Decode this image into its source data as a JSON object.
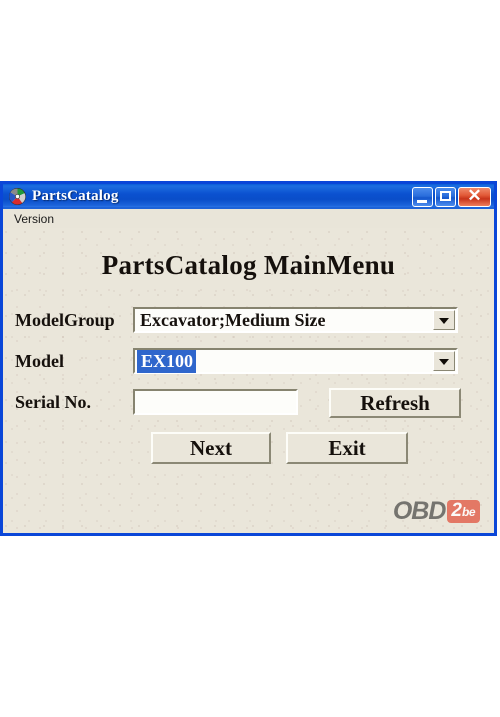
{
  "window": {
    "title": "PartsCatalog",
    "icon": "disc-icon",
    "titlebar_color": "#0b51d0",
    "border_color": "#0a46d8",
    "client_bg_color": "#eae6da",
    "buttons": {
      "minimize": "minimize-button",
      "maximize": "maximize-button",
      "close_glyph": "✕"
    }
  },
  "menu": {
    "items": [
      {
        "label": "Version"
      }
    ]
  },
  "main": {
    "heading": "PartsCatalog MainMenu",
    "fields": [
      {
        "label": "ModelGroup",
        "type": "combobox",
        "value": "Excavator;Medium Size",
        "selected": false
      },
      {
        "label": "Model",
        "type": "combobox",
        "value": "EX100",
        "selected": true,
        "selection_bg": "#2f66cc",
        "selection_fg": "#ffffff"
      },
      {
        "label": "Serial No.",
        "type": "textbox",
        "value": "",
        "placeholder": ""
      }
    ],
    "buttons": {
      "refresh": "Refresh",
      "next": "Next",
      "exit": "Exit"
    }
  },
  "watermark": {
    "text": "OBD",
    "badge_main": "2",
    "badge_sub": "be",
    "badge_color": "#e2604c",
    "text_color": "#5c5c58"
  }
}
